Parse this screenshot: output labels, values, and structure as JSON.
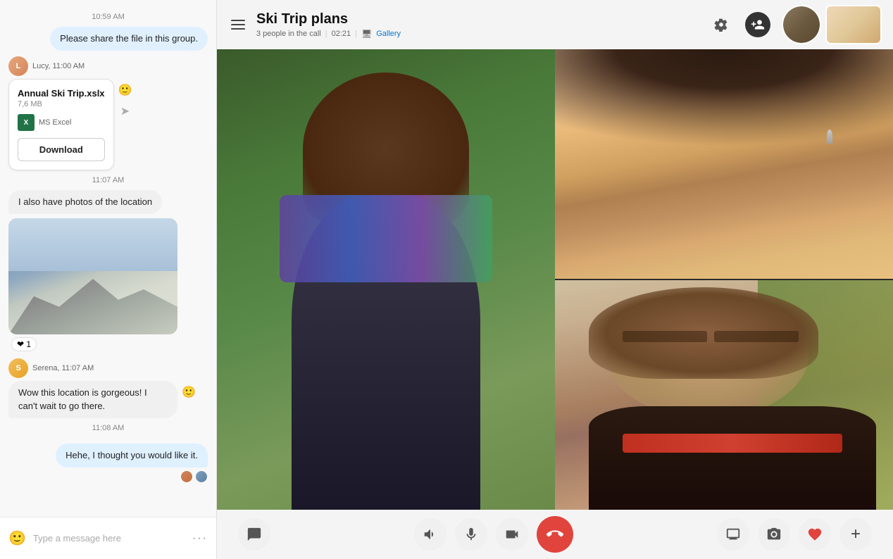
{
  "chat": {
    "timestamps": {
      "t1059": "10:59 AM",
      "t1100": "11:00 AM",
      "t1107": "11:07 AM",
      "t1108": "11:08 AM"
    },
    "messages": [
      {
        "id": "msg1",
        "type": "system-bubble",
        "text": "Please share the file in this group.",
        "time": "10:59 AM"
      },
      {
        "id": "msg2",
        "type": "file",
        "sender": "Lucy",
        "senderTime": "Lucy, 11:00 AM",
        "fileName": "Annual Ski Trip.xslx",
        "fileSize": "7,6 MB",
        "fileType": "MS Excel",
        "downloadLabel": "Download"
      },
      {
        "id": "msg3",
        "type": "text+photo",
        "sender": "Lucy",
        "senderTime": "11:07 AM",
        "text": "I also have photos of the location",
        "reaction": "❤",
        "reactionCount": "1"
      },
      {
        "id": "msg4",
        "type": "text",
        "sender": "Serena",
        "senderTime": "Serena, 11:07 AM",
        "text": "Wow this location is gorgeous! I can't wait to go there."
      },
      {
        "id": "msg5",
        "type": "text-self",
        "sender": "self",
        "senderTime": "11:08 AM",
        "text": "Hehe, I thought you would like it."
      }
    ],
    "input": {
      "placeholder": "Type a message here"
    }
  },
  "call": {
    "title": "Ski Trip plans",
    "meta": "3 people in the call",
    "duration": "02:21",
    "viewMode": "Gallery",
    "controls": {
      "chat": "💬",
      "speaker": "🔊",
      "mic": "🎤",
      "camera": "📷",
      "endCall": "📞",
      "screen": "⊡",
      "camSwitch": "📸",
      "heart": "❤",
      "add": "+"
    }
  }
}
